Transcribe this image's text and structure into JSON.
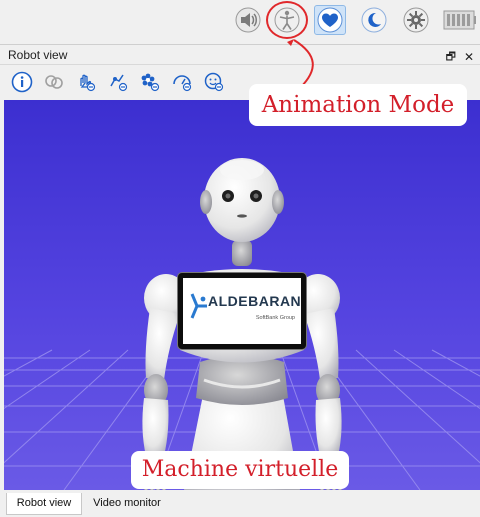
{
  "top_toolbar": {
    "buttons": [
      {
        "icon": "speaker-icon"
      },
      {
        "icon": "animation-mode-icon",
        "highlighted": true
      },
      {
        "icon": "heart-icon",
        "active": true
      },
      {
        "icon": "moon-icon"
      },
      {
        "icon": "gear-icon"
      },
      {
        "icon": "battery-icon"
      }
    ]
  },
  "dock": {
    "title": "Robot view",
    "float_label": "🗗",
    "close_label": "✕"
  },
  "sub_toolbar": {
    "icons": [
      "info-icon",
      "joints-icon",
      "left-hand-icon",
      "right-arm-icon",
      "flower-icon",
      "speedometer-icon",
      "face-icon"
    ]
  },
  "robot": {
    "chest_logo": "ALDEBARAN",
    "chest_sub": "SoftBank Group"
  },
  "annotations": {
    "animation_mode": "Animation Mode",
    "virtual_machine": "Machine virtuelle"
  },
  "tabs": [
    {
      "label": "Robot view",
      "active": true
    },
    {
      "label": "Video monitor",
      "active": false
    }
  ],
  "colors": {
    "viewport_bg": "#4a3ad6",
    "annotation_red": "#d31f2a",
    "active_blue": "#1f62c8"
  }
}
